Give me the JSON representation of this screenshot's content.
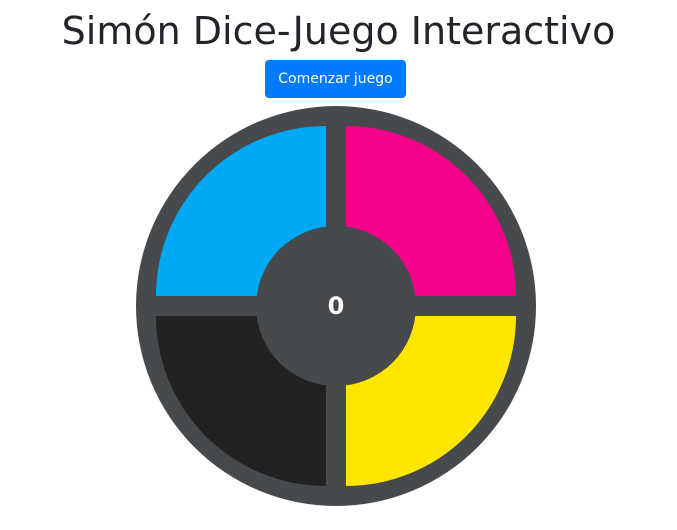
{
  "page": {
    "title": "Simón Dice-Juego Interactivo"
  },
  "controls": {
    "start_label": "Comenzar juego"
  },
  "game": {
    "score": "0",
    "pads": [
      {
        "id": "top-left",
        "color_name": "blue",
        "color": "#00a9f4"
      },
      {
        "id": "top-right",
        "color_name": "magenta",
        "color": "#f5008b"
      },
      {
        "id": "bottom-left",
        "color_name": "black",
        "color": "#222222"
      },
      {
        "id": "bottom-right",
        "color_name": "yellow",
        "color": "#ffe600"
      }
    ],
    "board_color": "#464a4d"
  },
  "colors": {
    "accent": "#007bff",
    "title_text": "#212529"
  }
}
